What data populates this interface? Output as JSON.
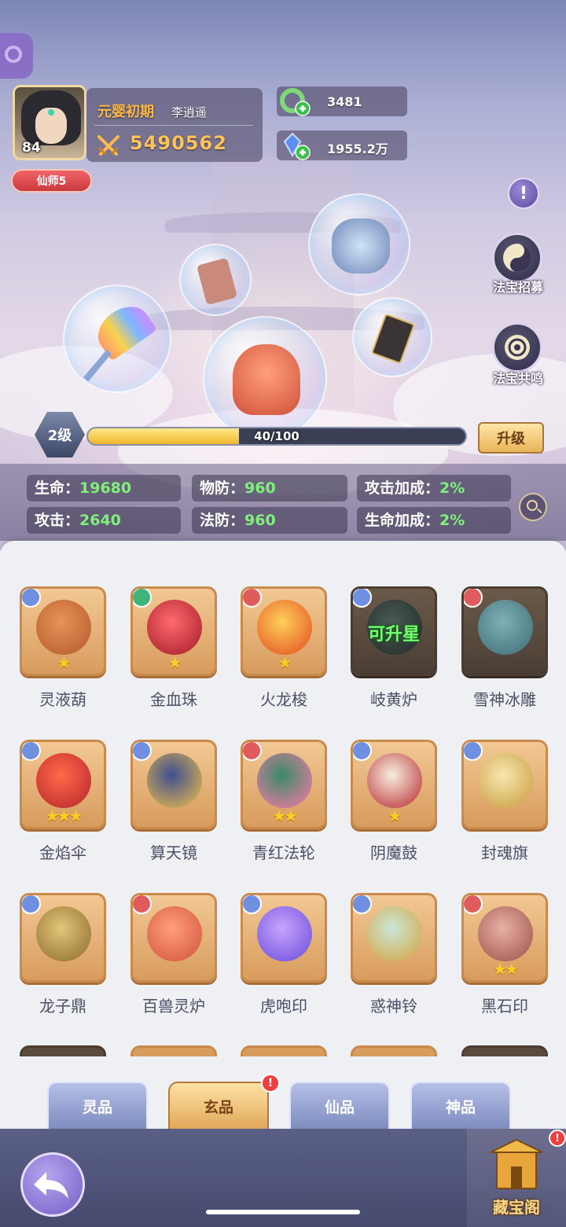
{
  "player": {
    "level": "84",
    "realm": "元婴初期",
    "name": "李逍遥",
    "power": "5490562",
    "vip": "仙师5"
  },
  "resources": [
    {
      "icon": "jade-coin-plus-icon",
      "value": "3481"
    },
    {
      "icon": "blue-crystal-plus-icon",
      "value": "1955.2万"
    }
  ],
  "side_buttons": {
    "info": "!",
    "recruit_label": "法宝招募",
    "resonance_label": "法宝共鸣"
  },
  "level_bar": {
    "level_label": "2级",
    "progress_text": "40/100",
    "progress": 0.4,
    "upgrade_label": "升级"
  },
  "stats": [
    {
      "label": "生命：",
      "value": "19680"
    },
    {
      "label": "物防：",
      "value": "960"
    },
    {
      "label": "攻击加成：",
      "value": "2%"
    },
    {
      "label": "攻击：",
      "value": "2640"
    },
    {
      "label": "法防：",
      "value": "960"
    },
    {
      "label": "生命加成：",
      "value": "2%"
    }
  ],
  "treasures": [
    {
      "name": "灵液葫",
      "stars": "★",
      "badge": "blue"
    },
    {
      "name": "金血珠",
      "stars": "★",
      "badge": "green"
    },
    {
      "name": "火龙梭",
      "stars": "★",
      "badge": "red"
    },
    {
      "name": "岐黄炉",
      "stars": "",
      "badge": "blue",
      "overlay": "可升星"
    },
    {
      "name": "雪神冰雕",
      "stars": "",
      "badge": "red"
    },
    {
      "name": "金焰伞",
      "stars": "★★★",
      "badge": "blue"
    },
    {
      "name": "算天镜",
      "stars": "",
      "badge": "blue"
    },
    {
      "name": "青红法轮",
      "stars": "★★",
      "badge": "red"
    },
    {
      "name": "阴魔鼓",
      "stars": "★",
      "badge": "blue"
    },
    {
      "name": "封魂旗",
      "stars": "",
      "badge": "blue"
    },
    {
      "name": "龙子鼎",
      "stars": "",
      "badge": "blue"
    },
    {
      "name": "百兽灵炉",
      "stars": "",
      "badge": "red"
    },
    {
      "name": "虎咆印",
      "stars": "",
      "badge": "blue"
    },
    {
      "name": "惑神铃",
      "stars": "",
      "badge": "blue"
    },
    {
      "name": "黑石印",
      "stars": "★★",
      "badge": "red"
    }
  ],
  "tabs": [
    {
      "label": "灵品",
      "active": false
    },
    {
      "label": "玄品",
      "active": true
    },
    {
      "label": "仙品",
      "active": false
    },
    {
      "label": "神品",
      "active": false
    }
  ],
  "tab_alert": "!",
  "bottom": {
    "treasure_label": "藏宝阁",
    "treasure_alert": "!"
  },
  "colors": {
    "accent_gold": "#ffc35a",
    "stat_value_green": "#7ff07a",
    "badge_blue": "#6f8fe0",
    "badge_green": "#3fb37a",
    "badge_red": "#e05b5b"
  }
}
